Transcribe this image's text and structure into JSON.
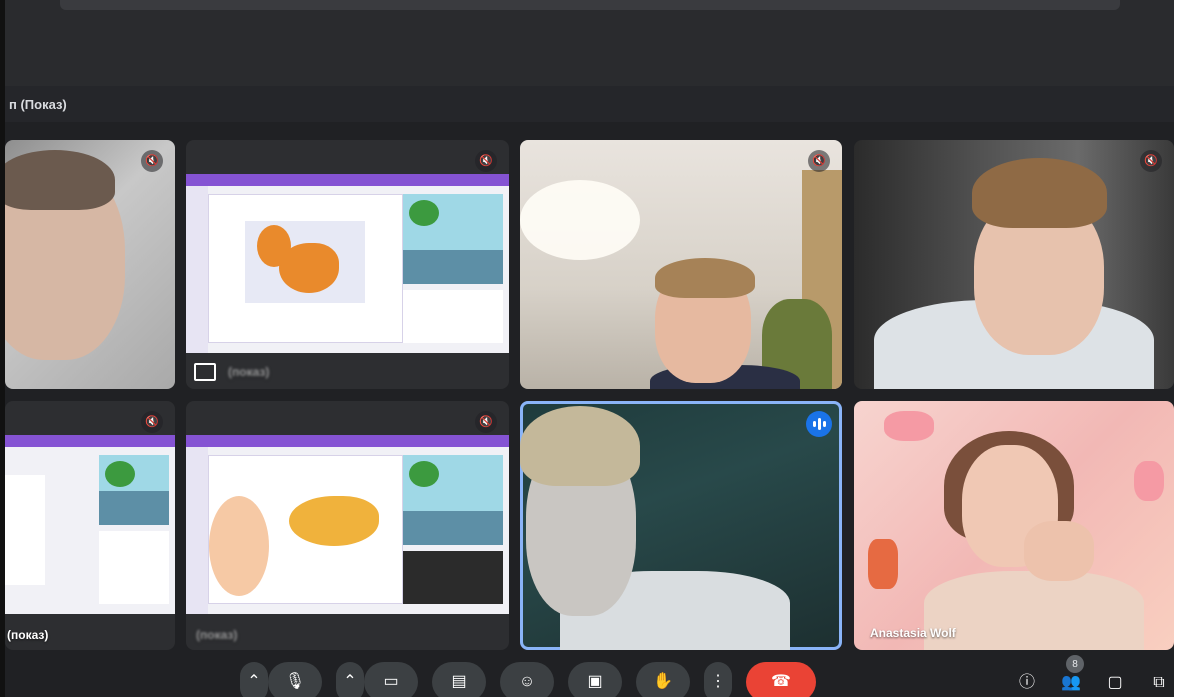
{
  "meeting": {
    "presentation_bar_label": "п (Показ)"
  },
  "tiles": [
    {
      "id": "tile-1",
      "name": "",
      "muted": true,
      "kind": "camera"
    },
    {
      "id": "tile-2",
      "name": "(показ)",
      "muted": true,
      "kind": "screen"
    },
    {
      "id": "tile-3",
      "name": "",
      "muted": true,
      "kind": "camera"
    },
    {
      "id": "tile-4",
      "name": "",
      "muted": true,
      "kind": "camera"
    },
    {
      "id": "tile-5",
      "name": "(показ)",
      "muted": true,
      "kind": "screen"
    },
    {
      "id": "tile-6",
      "name": "(показ)",
      "muted": true,
      "kind": "screen"
    },
    {
      "id": "tile-7",
      "name": "",
      "muted": false,
      "speaking": true,
      "kind": "camera"
    },
    {
      "id": "tile-8",
      "name": "Anastasia Wolf",
      "muted": false,
      "kind": "camera"
    }
  ],
  "controls": {
    "participants_count": "8",
    "icons": [
      "mic-icon",
      "camera-icon",
      "captions-icon",
      "emoji-icon",
      "present-icon",
      "raise-hand-icon",
      "more-icon",
      "end-call-icon"
    ],
    "right_icons": [
      "info-icon",
      "people-icon",
      "chat-icon",
      "activities-icon"
    ]
  },
  "colors": {
    "accent": "#8ab4f8",
    "end_call": "#ea4335",
    "speaking": "#1a73e8"
  }
}
